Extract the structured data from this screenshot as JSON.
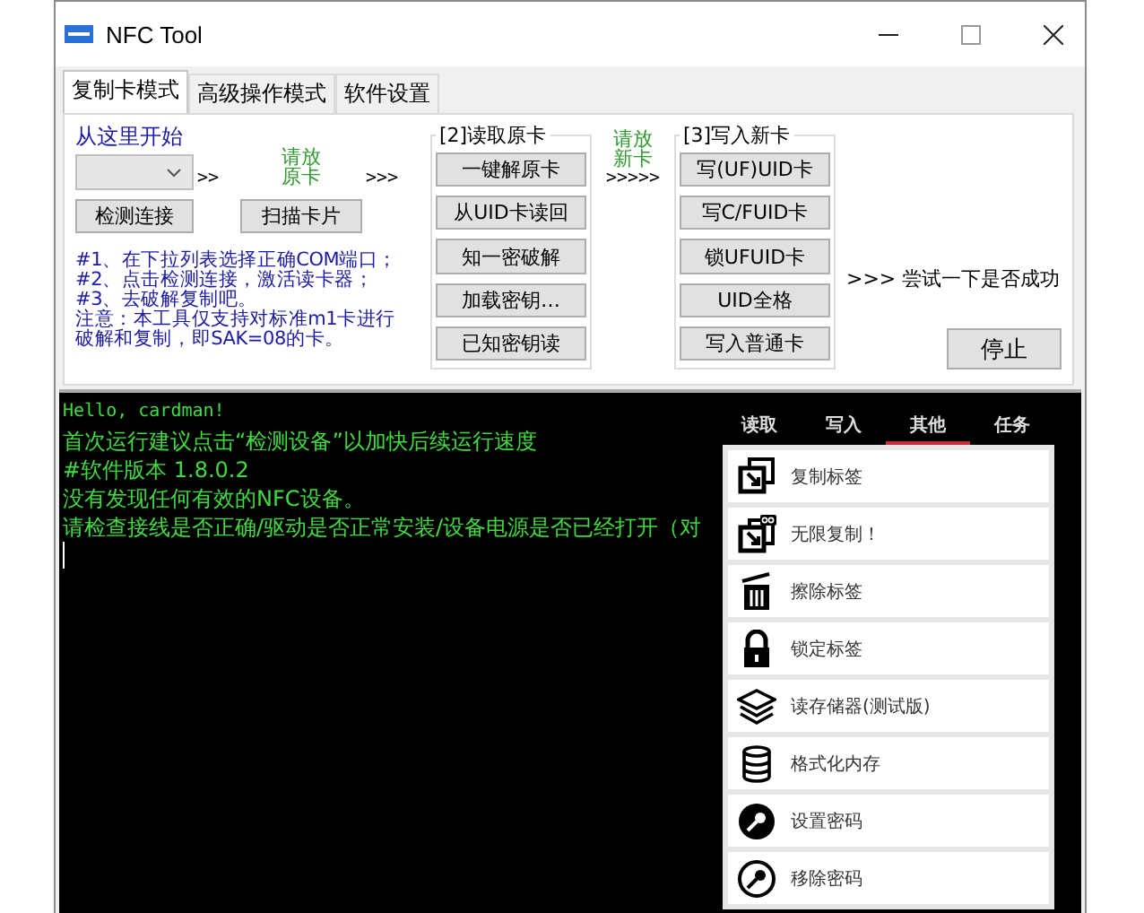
{
  "window": {
    "title": "NFC Tool"
  },
  "tabs": [
    {
      "label": "复制卡模式",
      "selected": true
    },
    {
      "label": "高级操作模式",
      "selected": false
    },
    {
      "label": "软件设置",
      "selected": false
    }
  ],
  "start": {
    "label": "从这里开始",
    "detect_button": "检测连接",
    "arrow_1": ">>",
    "place_card": "请放原卡",
    "scan_button": "扫描卡片",
    "arrow_2": ">>>"
  },
  "instructions": [
    "#1、在下拉列表选择正确COM端口；",
    "#2、点击检测连接，激活读卡器；",
    "#3、去破解复制吧。",
    "注意：本工具仅支持对标准m1卡进行破解和复制，即SAK=08的卡。"
  ],
  "read_group": {
    "title": "[2]读取原卡",
    "buttons": [
      "一键解原卡",
      "从UID卡读回",
      "知一密破解",
      "加载密钥…",
      "已知密钥读"
    ]
  },
  "place_new": {
    "label": "请放新卡",
    "arrow": ">>>>>"
  },
  "write_group": {
    "title": "[3]写入新卡",
    "buttons": [
      "写(UF)UID卡",
      "写C/FUID卡",
      "锁UFUID卡",
      "UID全格",
      "写入普通卡"
    ]
  },
  "result_hint": ">>> 尝试一下是否成功",
  "stop_button": "停止",
  "console": {
    "lines": [
      "Hello, cardman!",
      "首次运行建议点击“检测设备”以加快后续运行速度",
      "#软件版本 1.8.0.2",
      "没有发现任何有效的NFC设备。",
      "请检查接线是否正确/驱动是否正常安装/设备电源是否已经打开（对"
    ],
    "cursor": true
  },
  "phone": {
    "tabs": [
      {
        "label": "读取",
        "selected": false
      },
      {
        "label": "写入",
        "selected": false
      },
      {
        "label": "其他",
        "selected": true
      },
      {
        "label": "任务",
        "selected": false
      }
    ],
    "items": [
      {
        "label": "复制标签",
        "kind": "copy"
      },
      {
        "label": "无限复制！",
        "kind": "copy-infinite"
      },
      {
        "label": "擦除标签",
        "kind": "erase"
      },
      {
        "label": "锁定标签",
        "kind": "lock"
      },
      {
        "label": "读存储器(测试版)",
        "kind": "layers"
      },
      {
        "label": "格式化内存",
        "kind": "database"
      },
      {
        "label": "设置密码",
        "kind": "key"
      },
      {
        "label": "移除密码",
        "kind": "key-outline"
      }
    ]
  }
}
